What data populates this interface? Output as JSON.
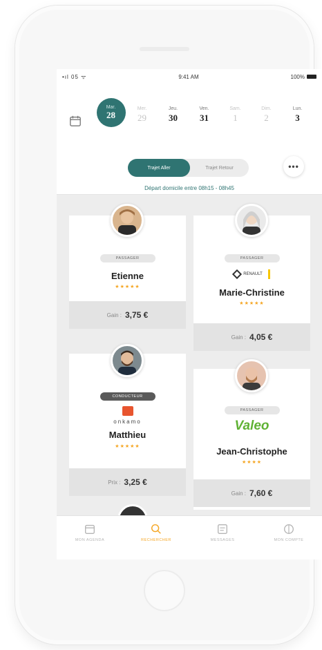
{
  "status_bar": {
    "signal": "•ıl 05 ᯤ",
    "time": "9:41 AM",
    "battery": "100%"
  },
  "header": {
    "calendar_icon": "calendar-icon",
    "days": [
      {
        "dow": "Mar.",
        "num": "28",
        "state": "active"
      },
      {
        "dow": "Mer.",
        "num": "29",
        "state": "muted"
      },
      {
        "dow": "Jeu.",
        "num": "30",
        "state": "normal"
      },
      {
        "dow": "Ven.",
        "num": "31",
        "state": "normal"
      },
      {
        "dow": "Sam.",
        "num": "1",
        "state": "muted"
      },
      {
        "dow": "Dim.",
        "num": "2",
        "state": "muted"
      },
      {
        "dow": "Lun.",
        "num": "3",
        "state": "normal"
      }
    ],
    "toggle": {
      "active": "Trajet Aller",
      "inactive": "Trajet Retour"
    },
    "more": "•••",
    "subtitle": "Départ domicile entre 08h15 - 08h45"
  },
  "cards": [
    {
      "badge": "PASSAGER",
      "name": "Etienne",
      "stars": "★★★★★",
      "footer_label": "Gain :",
      "footer_amount": "3,75 €"
    },
    {
      "badge": "PASSAGER",
      "logo": "RENAULT",
      "name": "Marie-Christine",
      "stars": "★★★★★",
      "footer_label": "Gain :",
      "footer_amount": "4,05 €"
    },
    {
      "badge": "CONDUCTEUR",
      "logo": "onkamo",
      "name": "Matthieu",
      "stars": "★★★★★",
      "footer_label": "Prix :",
      "footer_amount": "3,25 €"
    },
    {
      "badge": "PASSAGER",
      "logo": "Valeo",
      "name": "Jean-Christophe",
      "stars": "★★★★",
      "footer_label": "Gain :",
      "footer_amount": "7,60 €"
    }
  ],
  "tabs": [
    {
      "label": "MON AGENDA",
      "icon": "calendar-icon"
    },
    {
      "label": "RECHERCHER",
      "icon": "search-icon",
      "active": true
    },
    {
      "label": "MESSAGES",
      "icon": "message-icon"
    },
    {
      "label": "MON COMPTE",
      "icon": "account-icon"
    }
  ],
  "colors": {
    "accent": "#2f7472",
    "stars": "#f5a623",
    "tab_active": "#f5a623",
    "valeo": "#5fb234"
  }
}
